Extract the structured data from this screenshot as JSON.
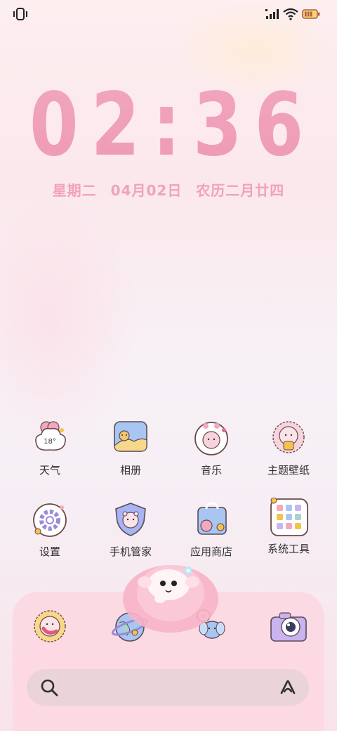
{
  "clock": {
    "time": "02:36"
  },
  "date": {
    "weekday": "星期二",
    "date": "04月02日",
    "lunar": "农历二月廿四"
  },
  "apps": [
    {
      "label": "天气",
      "icon": "weather-cloud-icon",
      "temp": "18°"
    },
    {
      "label": "相册",
      "icon": "gallery-icon"
    },
    {
      "label": "音乐",
      "icon": "music-icon"
    },
    {
      "label": "主题壁纸",
      "icon": "theme-wallpaper-icon"
    },
    {
      "label": "设置",
      "icon": "settings-gear-icon"
    },
    {
      "label": "手机管家",
      "icon": "phone-manager-shield-icon"
    },
    {
      "label": "应用商店",
      "icon": "app-store-bag-icon"
    },
    {
      "label": "系统工具",
      "icon": "system-tools-folder-icon"
    }
  ],
  "dock": [
    "phone-icon",
    "browser-globe-icon",
    "messages-elephant-icon",
    "camera-icon"
  ],
  "colors": {
    "accent": "#f0a3bb",
    "text": "#2f2f33",
    "dock": "#fcd8e2",
    "search": "#ead3d9"
  }
}
